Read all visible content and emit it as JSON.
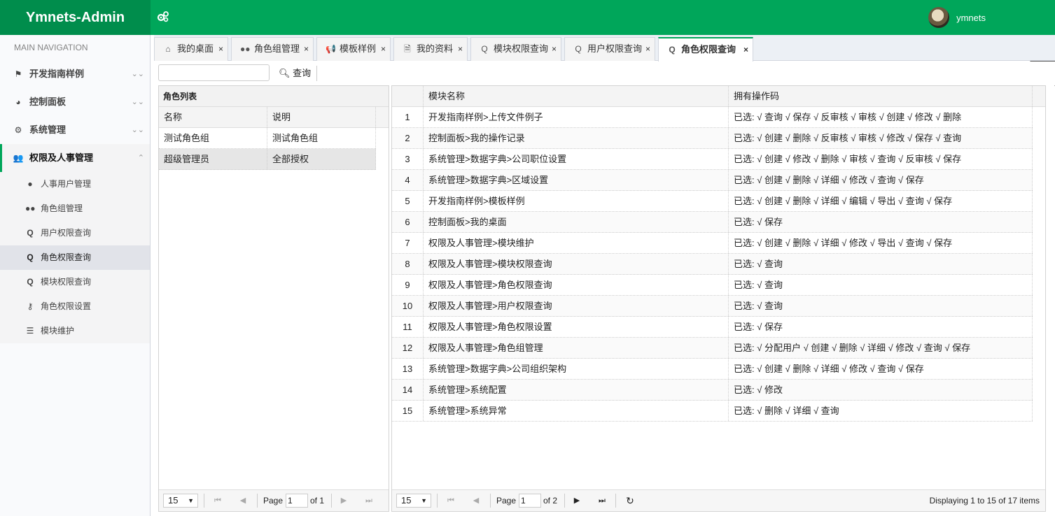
{
  "app": {
    "title": "Ymnets-Admin",
    "username": "ymnets"
  },
  "sidebar": {
    "header": "MAIN NAVIGATION",
    "menus": [
      {
        "label": "开发指南样例",
        "icon": "flag-icon",
        "chevron": "⌄⌄"
      },
      {
        "label": "控制面板",
        "icon": "dashboard-icon",
        "chevron": "⌄⌄"
      },
      {
        "label": "系统管理",
        "icon": "cogs-icon",
        "chevron": "⌄⌄"
      },
      {
        "label": "权限及人事管理",
        "icon": "users-icon",
        "chevron": "⌃"
      }
    ],
    "submenu": [
      {
        "label": "人事用户管理",
        "icon": "user-icon"
      },
      {
        "label": "角色组管理",
        "icon": "users-icon"
      },
      {
        "label": "用户权限查询",
        "icon": "search-icon"
      },
      {
        "label": "角色权限查询",
        "icon": "search-icon"
      },
      {
        "label": "模块权限查询",
        "icon": "search-icon"
      },
      {
        "label": "角色权限设置",
        "icon": "key-icon"
      },
      {
        "label": "模块维护",
        "icon": "list-icon"
      }
    ]
  },
  "tabs": [
    {
      "label": "我的桌面",
      "icon": "home-icon"
    },
    {
      "label": "角色组管理",
      "icon": "users-icon"
    },
    {
      "label": "模板样例",
      "icon": "bullhorn-icon"
    },
    {
      "label": "我的资料",
      "icon": "file-icon"
    },
    {
      "label": "模块权限查询",
      "icon": "search-icon"
    },
    {
      "label": "用户权限查询",
      "icon": "search-icon"
    },
    {
      "label": "角色权限查询",
      "icon": "search-icon",
      "active": true
    }
  ],
  "toolbar": {
    "search_value": "",
    "search_button": "查询"
  },
  "role_panel": {
    "title": "角色列表",
    "columns": [
      "名称",
      "说明"
    ],
    "rows": [
      [
        "测试角色组",
        "测试角色组"
      ],
      [
        "超级管理员",
        "全部授权"
      ]
    ],
    "pager": {
      "page_size": "15",
      "page_label": "Page",
      "page": "1",
      "of_label": "of 1"
    }
  },
  "module_panel": {
    "columns": [
      "模块名称",
      "拥有操作码"
    ],
    "rows": [
      [
        "1",
        "开发指南样例>上传文件例子",
        "已选: √ 查询 √ 保存 √ 反审核 √ 审核 √ 创建 √ 修改 √ 删除"
      ],
      [
        "2",
        "控制面板>我的操作记录",
        "已选: √ 创建 √ 删除 √ 反审核 √ 审核 √ 修改 √ 保存 √ 查询"
      ],
      [
        "3",
        "系统管理>数据字典>公司职位设置",
        "已选: √ 创建 √ 修改 √ 删除 √ 审核 √ 查询 √ 反审核 √ 保存"
      ],
      [
        "4",
        "系统管理>数据字典>区域设置",
        "已选: √ 创建 √ 删除 √ 详细 √ 修改 √ 查询 √ 保存"
      ],
      [
        "5",
        "开发指南样例>模板样例",
        "已选: √ 创建 √ 删除 √ 详细 √ 编辑 √ 导出 √ 查询 √ 保存"
      ],
      [
        "6",
        "控制面板>我的桌面",
        "已选: √ 保存"
      ],
      [
        "7",
        "权限及人事管理>模块维护",
        "已选: √ 创建 √ 删除 √ 详细 √ 修改 √ 导出 √ 查询 √ 保存"
      ],
      [
        "8",
        "权限及人事管理>模块权限查询",
        "已选: √ 查询"
      ],
      [
        "9",
        "权限及人事管理>角色权限查询",
        "已选: √ 查询"
      ],
      [
        "10",
        "权限及人事管理>用户权限查询",
        "已选: √ 查询"
      ],
      [
        "11",
        "权限及人事管理>角色权限设置",
        "已选: √ 保存"
      ],
      [
        "12",
        "权限及人事管理>角色组管理",
        "已选: √ 分配用户 √ 创建 √ 删除 √ 详细 √ 修改 √ 查询 √ 保存"
      ],
      [
        "13",
        "系统管理>数据字典>公司组织架构",
        "已选: √ 创建 √ 删除 √ 详细 √ 修改 √ 查询 √ 保存"
      ],
      [
        "14",
        "系统管理>系统配置",
        "已选: √ 修改"
      ],
      [
        "15",
        "系统管理>系统异常",
        "已选: √ 删除 √ 详细 √ 查询"
      ]
    ],
    "pager": {
      "page_size": "15",
      "page_label": "Page",
      "page": "1",
      "of_label": "of 2",
      "info": "Displaying 1 to 15 of 17 items"
    }
  },
  "colors": {
    "brand": "#00a65a",
    "brand_dark": "#008d4c"
  }
}
